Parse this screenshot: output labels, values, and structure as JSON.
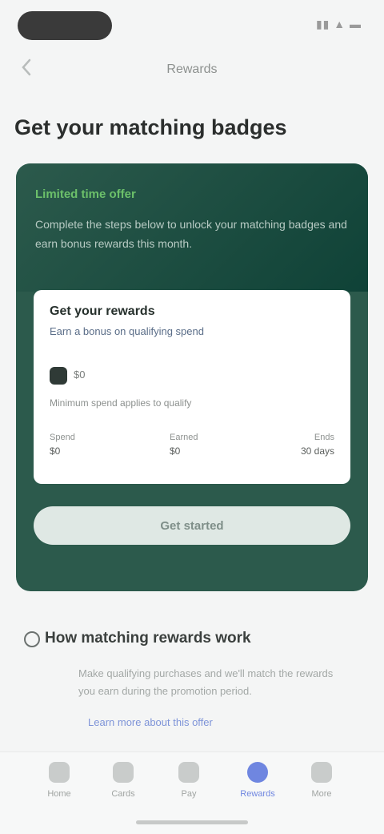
{
  "status_bar": {
    "time": "",
    "indicators": "▮▮ ▲ ▬"
  },
  "nav": {
    "back_icon": "chevron-left-icon",
    "title": "Rewards"
  },
  "page": {
    "title": "Get your matching badges"
  },
  "promo_card": {
    "eyebrow": "Limited time offer",
    "description": "Complete the steps below to unlock your matching badges and earn bonus rewards this month.",
    "colors": {
      "background": "#2c5a4c",
      "accent": "#6cc06a"
    },
    "offer": {
      "title": "Get your rewards",
      "subtitle": "Earn a bonus on qualifying spend",
      "amount": "$0",
      "note": "Minimum spend applies to qualify",
      "stats": [
        {
          "label": "Spend",
          "value": "$0"
        },
        {
          "label": "Earned",
          "value": "$0"
        },
        {
          "label": "Ends",
          "value": "30 days"
        }
      ]
    },
    "cta_label": "Get started"
  },
  "info": {
    "icon": "info-icon",
    "heading": "How matching rewards work",
    "body": "Make qualifying purchases and we'll match the rewards you earn during the promotion period.",
    "link": "Learn more about this offer"
  },
  "tabs": [
    {
      "label": "Home",
      "icon": "home-icon"
    },
    {
      "label": "Cards",
      "icon": "card-icon"
    },
    {
      "label": "Pay",
      "icon": "pay-icon"
    },
    {
      "label": "Rewards",
      "icon": "rewards-icon"
    },
    {
      "label": "More",
      "icon": "more-icon"
    }
  ],
  "active_tab_color": "#6f86e0"
}
